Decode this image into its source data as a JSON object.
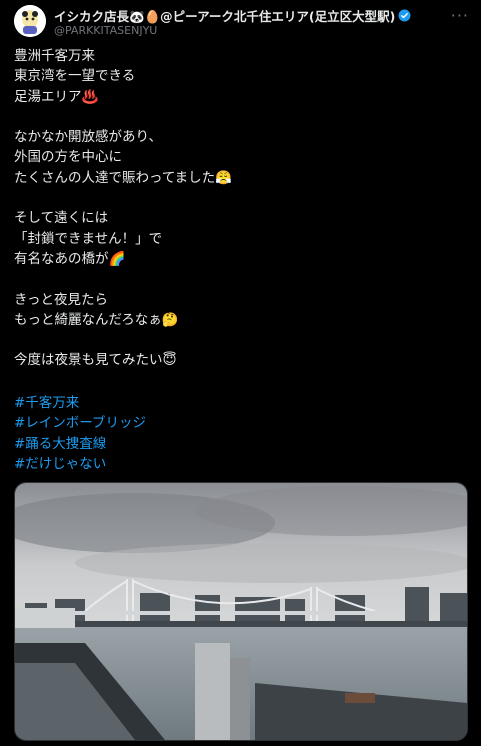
{
  "tweet": {
    "display_name": "イシカク店長🐼🥚@ピーアーク北千住エリア(足立区大型駅)",
    "handle": "@PARKKITASENJYU",
    "more_label": "···",
    "paragraphs": [
      [
        "豊洲千客万来",
        "東京湾を一望できる",
        "足湯エリア♨️"
      ],
      [
        "なかなか開放感があり、",
        "外国の方を中心に",
        "たくさんの人達で賑わってました😤"
      ],
      [
        "そして遠くには",
        "「封鎖できません！」で",
        "有名なあの橋が🌈"
      ],
      [
        "きっと夜見たら",
        "もっと綺麗なんだろなぁ🤔"
      ],
      [
        "今度は夜景も見てみたい😇"
      ]
    ],
    "hashtags": [
      "#千客万来",
      "#レインボーブリッジ",
      "#踊る大捜査線",
      "#だけじゃない"
    ]
  },
  "colors": {
    "link": "#1d9bf0",
    "text": "#e7e9ea",
    "muted": "#71767b",
    "background": "#000000"
  },
  "icons": {
    "verified": "verified-badge-icon",
    "more": "more-options-icon"
  }
}
